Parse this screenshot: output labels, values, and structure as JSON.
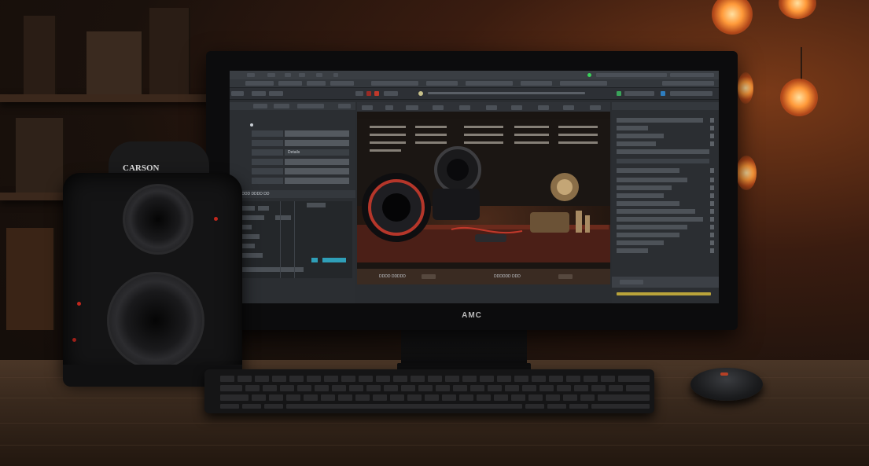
{
  "scene": {
    "monitor_brand": "AMC",
    "camera_brand": "CARSON"
  },
  "app": {
    "left_panel": {
      "field_value": "Details",
      "timeline_header": "DDDDD DDDD DD"
    },
    "viewer": {
      "footer_left": "DDDD DDDDD",
      "footer_right": "DDDDDD DDD"
    }
  }
}
